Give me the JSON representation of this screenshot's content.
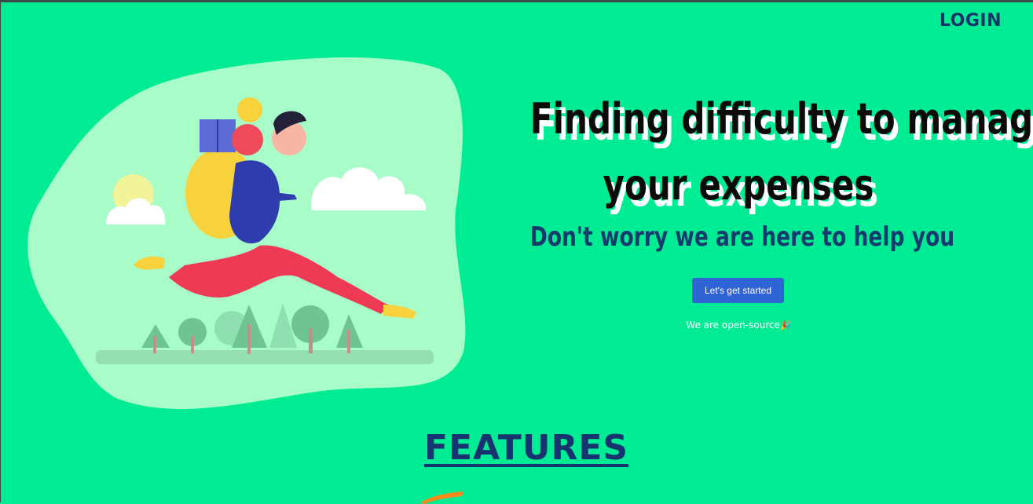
{
  "nav": {
    "login_label": "LOGIN"
  },
  "hero": {
    "headline_line1": "Finding difficulty to manage",
    "headline_line2": "your expenses",
    "subheadline": "Don't worry we are here to help you",
    "cta_label": "Let's get started",
    "open_source_text": "We are open-source",
    "open_source_icon": "party-popper-icon"
  },
  "features": {
    "title": "FEATURES"
  },
  "colors": {
    "background": "#00ec94",
    "blob": "#a8fcc8",
    "headline": "#0b0b0b",
    "subheadline": "#153a6e",
    "cta": "#2f63d6",
    "login": "#16336a"
  }
}
